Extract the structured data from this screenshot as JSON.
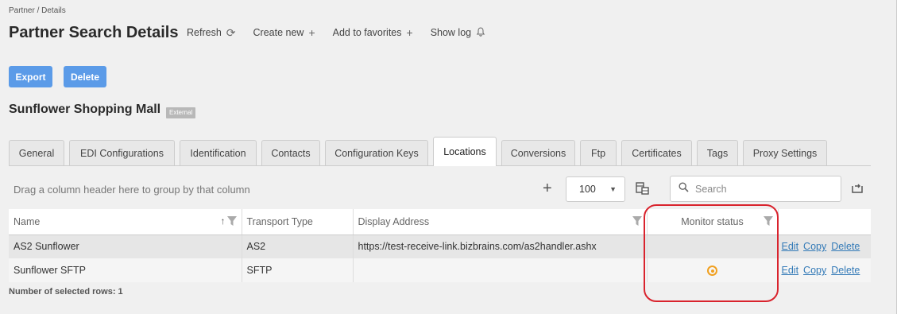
{
  "breadcrumb": "Partner / Details",
  "page_title": "Partner Search Details",
  "toolbar": {
    "refresh": "Refresh",
    "create_new": "Create new",
    "add_to_favorites": "Add to favorites",
    "show_log": "Show log"
  },
  "buttons": {
    "export": "Export",
    "delete": "Delete"
  },
  "partner": {
    "name": "Sunflower Shopping Mall",
    "badge": "External"
  },
  "tabs": [
    {
      "label": "General"
    },
    {
      "label": "EDI Configurations"
    },
    {
      "label": "Identification"
    },
    {
      "label": "Contacts"
    },
    {
      "label": "Configuration Keys"
    },
    {
      "label": "Locations"
    },
    {
      "label": "Conversions"
    },
    {
      "label": "Ftp"
    },
    {
      "label": "Certificates"
    },
    {
      "label": "Tags"
    },
    {
      "label": "Proxy Settings"
    }
  ],
  "active_tab": "Locations",
  "grid": {
    "group_hint": "Drag a column header here to group by that column",
    "page_size": "100",
    "search_placeholder": "Search",
    "columns": [
      "Name",
      "Transport Type",
      "Display Address",
      "Monitor status"
    ],
    "rows": [
      {
        "name": "AS2 Sunflower",
        "transport": "AS2",
        "address": "https://test-receive-link.bizbrains.com/as2handler.ashx",
        "monitor_status": ""
      },
      {
        "name": "Sunflower SFTP",
        "transport": "SFTP",
        "address": "",
        "monitor_status": "warning"
      }
    ],
    "actions": {
      "edit": "Edit",
      "copy": "Copy",
      "delete": "Delete"
    },
    "selected_rows": "Number of selected rows: 1"
  },
  "colors": {
    "accent": "#5b9be8",
    "link": "#337ab7",
    "status_warning": "#f0a020",
    "highlight": "#d9232d"
  }
}
